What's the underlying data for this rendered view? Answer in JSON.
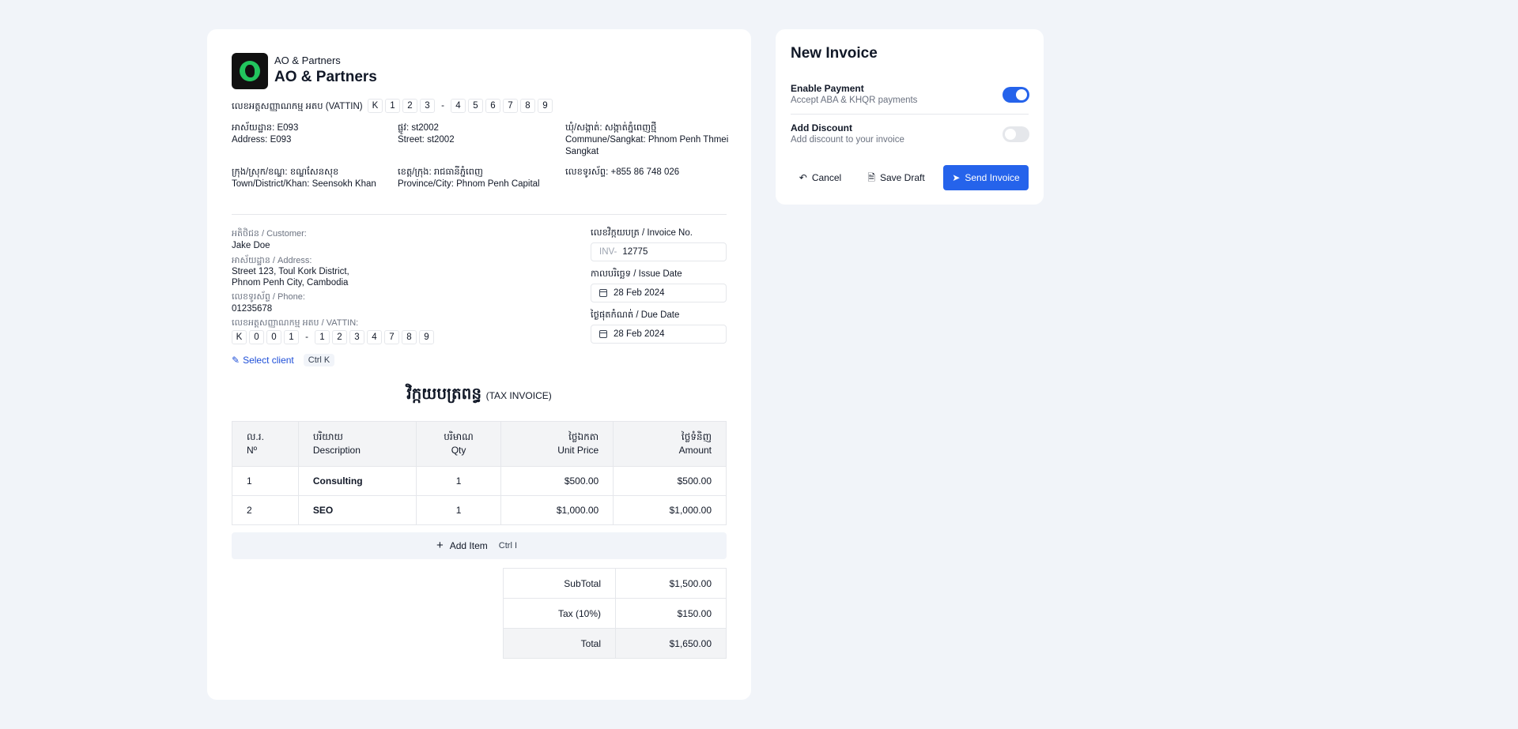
{
  "company": {
    "name_small": "AO & Partners",
    "name_big": "AO & Partners",
    "vat_label": "លេខអត្តសញ្ញាណកម្ម អតប (VATTIN)",
    "vat_chars": [
      "K",
      "1",
      "2",
      "3",
      "-",
      "4",
      "5",
      "6",
      "7",
      "8",
      "9"
    ],
    "address": {
      "house_km": "អាស័យដ្ឋាន: E093",
      "house_en": "Address: E093",
      "street_km": "ផ្លូវ: st2002",
      "street_en": "Street: st2002",
      "commune_km": "ឃុំ/សង្កាត់: សង្កាត់ភ្នំពេញថ្មី",
      "commune_en": "Commune/Sangkat: Phnom Penh Thmei Sangkat",
      "district_km": "ក្រុង/ស្រុក/ខណ្ឌ: ខណ្ឌសែនសុខ",
      "district_en": "Town/District/Khan: Seensokh Khan",
      "province_km": "ខេត្ត/ក្រុង: រាជធានីភ្នំពេញ",
      "province_en": "Province/City: Phnom Penh Capital",
      "phone": "លេខទូរស័ព្ទ: +855 86 748 026"
    }
  },
  "customer": {
    "customer_label": "អតិថិជន / Customer:",
    "customer_value": "Jake Doe",
    "address_label": "អាស័យដ្ឋាន / Address:",
    "address_line1": "Street 123, Toul Kork District,",
    "address_line2": "Phnom Penh City, Cambodia",
    "phone_label": "លេខទូរស័ព្ទ / Phone:",
    "phone_value": "01235678",
    "vat_label": "លេខអត្តសញ្ញាណកម្ម អតប / VATTIN:",
    "vat_chars": [
      "K",
      "0",
      "0",
      "1",
      "-",
      "1",
      "2",
      "3",
      "4",
      "7",
      "8",
      "9"
    ],
    "select_client": "Select client",
    "select_shortcut": "Ctrl K"
  },
  "invoice_meta": {
    "number_label": "លេខវិក្កយបត្រ / Invoice No.",
    "number_prefix": "INV-",
    "number_value": "12775",
    "issue_label": "កាលបរិច្ឆេទ / Issue Date",
    "issue_value": "28 Feb 2024",
    "due_label": "ថ្ងៃផុតកំណត់ / Due Date",
    "due_value": "28 Feb 2024"
  },
  "title": {
    "km": "វិក្កយបត្រពន្ធ",
    "en": "(TAX INVOICE)"
  },
  "table": {
    "headers": [
      {
        "km": "ល.រ.",
        "en": "Nº"
      },
      {
        "km": "បរិយាយ",
        "en": "Description"
      },
      {
        "km": "បរិមាណ",
        "en": "Qty"
      },
      {
        "km": "ថ្លៃឯកតា",
        "en": "Unit Price"
      },
      {
        "km": "ថ្លៃទំនិញ",
        "en": "Amount"
      }
    ],
    "rows": [
      {
        "no": "1",
        "description": "Consulting",
        "qty": "1",
        "unit_price": "$500.00",
        "amount": "$500.00"
      },
      {
        "no": "2",
        "description": "SEO",
        "qty": "1",
        "unit_price": "$1,000.00",
        "amount": "$1,000.00"
      }
    ],
    "add_item": "Add Item",
    "add_item_shortcut": "Ctrl I"
  },
  "totals": {
    "subtotal_label": "SubTotal",
    "subtotal_value": "$1,500.00",
    "tax_label": "Tax (10%)",
    "tax_value": "$150.00",
    "total_label": "Total",
    "total_value": "$1,650.00"
  },
  "side": {
    "title": "New Invoice",
    "payment_title": "Enable Payment",
    "payment_sub": "Accept ABA & KHQR payments",
    "payment_enabled": true,
    "discount_title": "Add Discount",
    "discount_sub": "Add discount to your invoice",
    "discount_enabled": false,
    "cancel": "Cancel",
    "save_draft": "Save Draft",
    "send_invoice": "Send Invoice",
    "accent_color": "#2563eb"
  }
}
